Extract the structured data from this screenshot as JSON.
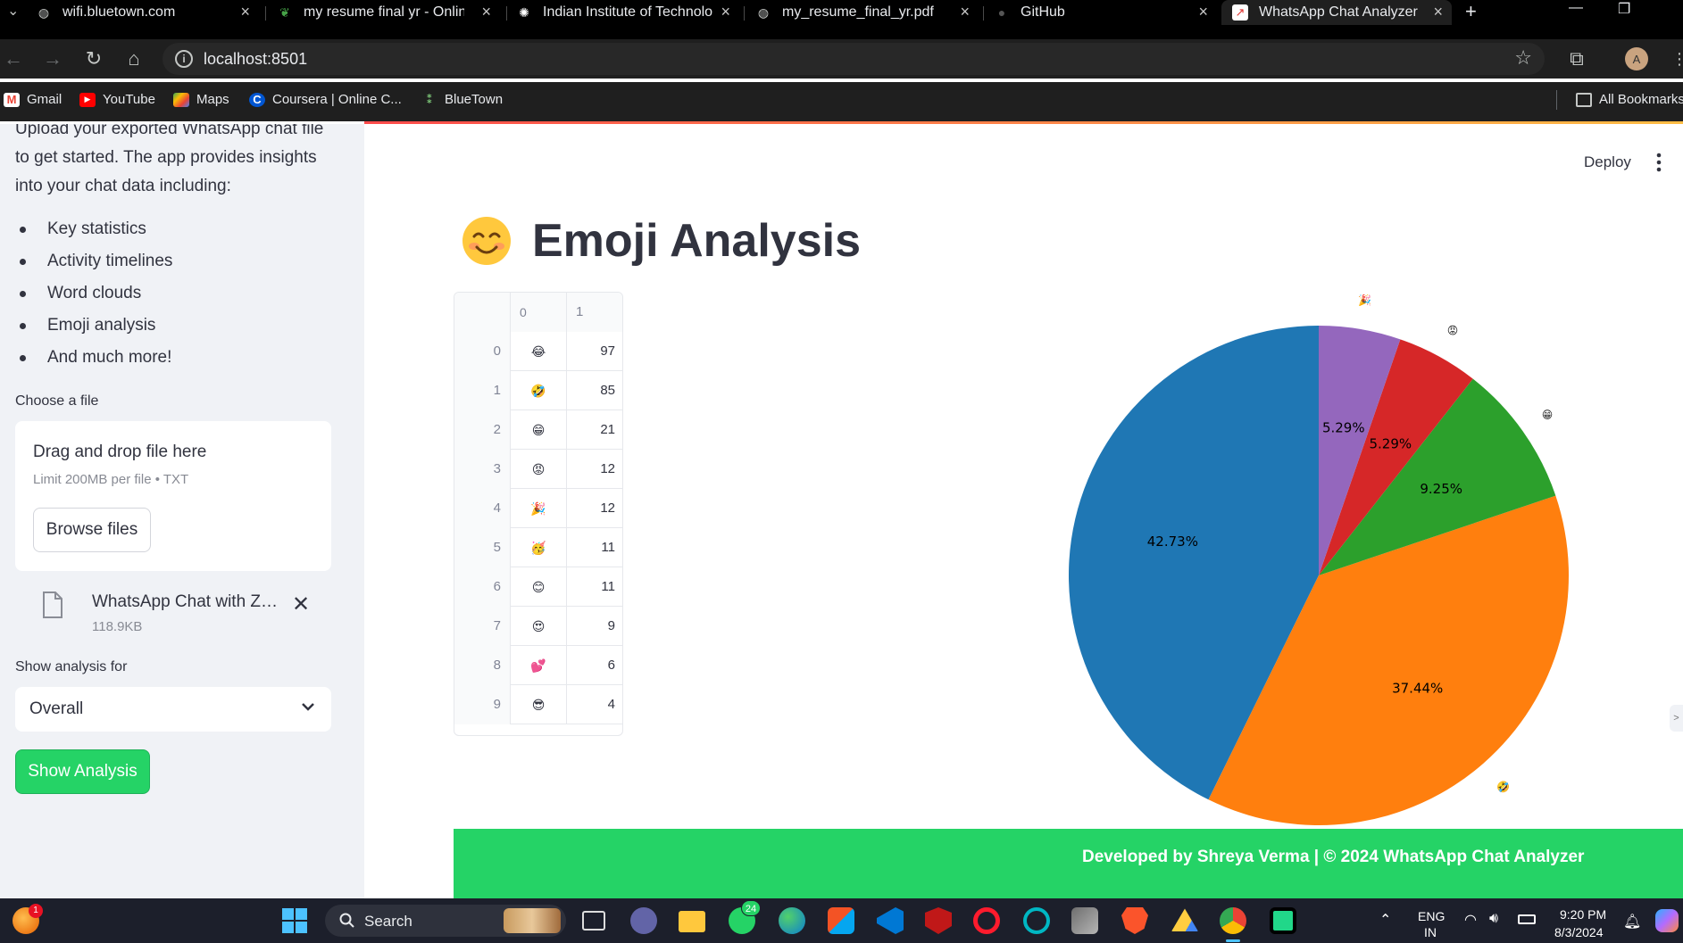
{
  "browser": {
    "tabs": [
      {
        "title": "wifi.bluetown.com",
        "favicon": "globe-icon"
      },
      {
        "title": "my resume final yr - Online",
        "favicon": "overleaf-icon"
      },
      {
        "title": "Indian Institute of Technolo",
        "favicon": "iit-logo-icon"
      },
      {
        "title": "my_resume_final_yr.pdf",
        "favicon": "globe-icon"
      },
      {
        "title": "GitHub",
        "favicon": "github-icon"
      },
      {
        "title": "WhatsApp Chat Analyzer",
        "favicon": "chart-icon",
        "active": true
      }
    ],
    "url": "localhost:8501",
    "bookmarks": [
      {
        "label": "Gmail",
        "icon": "gmail-icon"
      },
      {
        "label": "YouTube",
        "icon": "youtube-icon"
      },
      {
        "label": "Maps",
        "icon": "maps-icon"
      },
      {
        "label": "Coursera | Online C...",
        "icon": "coursera-icon"
      },
      {
        "label": "BlueTown",
        "icon": "bluetown-icon"
      }
    ],
    "all_bookmarks": "All Bookmarks",
    "accent_gradient": [
      "#ff4b4b",
      "#ffbd45"
    ]
  },
  "sidebar": {
    "intro": "Upload your exported WhatsApp chat file to get started. The app provides insights into your chat data including:",
    "features": [
      "Key statistics",
      "Activity timelines",
      "Word clouds",
      "Emoji analysis",
      "And much more!"
    ],
    "file_label": "Choose a file",
    "dropzone_title": "Drag and drop file here",
    "dropzone_limit": "Limit 200MB per file • TXT",
    "browse_label": "Browse files",
    "uploaded_file": {
      "name": "WhatsApp Chat with Zoya.txt",
      "size": "118.9KB"
    },
    "analysis_label": "Show analysis for",
    "analysis_value": "Overall",
    "show_button": "Show Analysis"
  },
  "header": {
    "deploy": "Deploy"
  },
  "main": {
    "title": "Emoji Analysis",
    "title_emoji": "smiling-face-icon",
    "table": {
      "columns": [
        "0",
        "1"
      ],
      "rows": [
        {
          "idx": "0",
          "emoji": "😂",
          "count": "97"
        },
        {
          "idx": "1",
          "emoji": "🤣",
          "count": "85"
        },
        {
          "idx": "2",
          "emoji": "😁",
          "count": "21"
        },
        {
          "idx": "3",
          "emoji": "😡",
          "count": "12"
        },
        {
          "idx": "4",
          "emoji": "🎉",
          "count": "12"
        },
        {
          "idx": "5",
          "emoji": "🥳",
          "count": "11"
        },
        {
          "idx": "6",
          "emoji": "😊",
          "count": "11"
        },
        {
          "idx": "7",
          "emoji": "😍",
          "count": "9"
        },
        {
          "idx": "8",
          "emoji": "💕",
          "count": "6"
        },
        {
          "idx": "9",
          "emoji": "😎",
          "count": "4"
        }
      ]
    }
  },
  "chart_data": {
    "type": "pie",
    "title": "",
    "slices": [
      {
        "label": "😂",
        "value": 42.73,
        "pct_label": "42.73%",
        "color": "#1f77b4"
      },
      {
        "label": "🤣",
        "value": 37.44,
        "pct_label": "37.44%",
        "color": "#ff7f0e"
      },
      {
        "label": "😁",
        "value": 9.25,
        "pct_label": "9.25%",
        "color": "#2ca02c"
      },
      {
        "label": "😡",
        "value": 5.29,
        "pct_label": "5.29%",
        "color": "#d62728"
      },
      {
        "label": "🎉",
        "value": 5.29,
        "pct_label": "5.29%",
        "color": "#9467bd"
      }
    ],
    "start_angle_deg": 90,
    "direction": "counterclockwise"
  },
  "footer": {
    "text": "Developed by Shreya Verma | © 2024 WhatsApp Chat Analyzer",
    "color": "#25d366"
  },
  "taskbar": {
    "search": "Search",
    "notification_badge": "1",
    "whatsapp_badge": "24",
    "lang": "ENG",
    "region": "IN",
    "time": "9:20 PM",
    "date": "8/3/2024"
  }
}
